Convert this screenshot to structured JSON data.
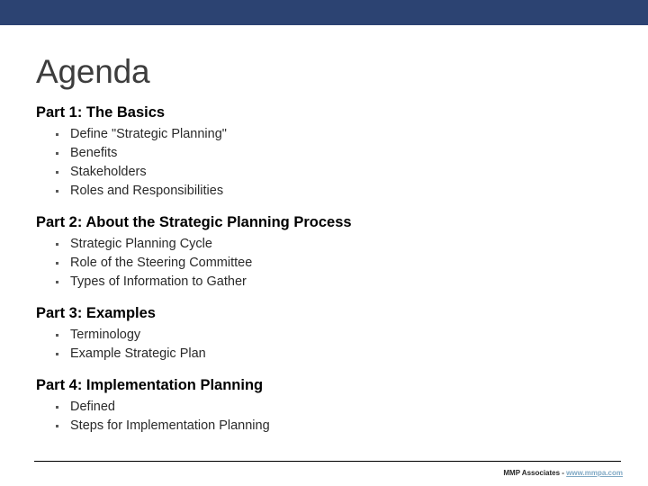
{
  "slide": {
    "title": "Agenda",
    "accent_color": "#2c4372",
    "title_color": "#3d3d3d",
    "background_color": "#ffffff"
  },
  "sections": [
    {
      "heading": "Part 1: The Basics",
      "bullets": [
        "Define \"Strategic Planning\"",
        "Benefits",
        "Stakeholders",
        "Roles and Responsibilities"
      ]
    },
    {
      "heading": "Part 2: About the Strategic Planning Process",
      "bullets": [
        "Strategic Planning Cycle",
        "Role of the Steering Committee",
        "Types of Information to Gather"
      ]
    },
    {
      "heading": "Part 3: Examples",
      "bullets": [
        "Terminology",
        "Example Strategic Plan"
      ]
    },
    {
      "heading": "Part 4: Implementation Planning",
      "bullets": [
        "Defined",
        "Steps for Implementation Planning"
      ]
    }
  ],
  "footer": {
    "credit": "MMP Associates - ",
    "link_text": "www.mmpa.com",
    "link_color": "#7fa8c4",
    "rule_color": "#000000"
  }
}
